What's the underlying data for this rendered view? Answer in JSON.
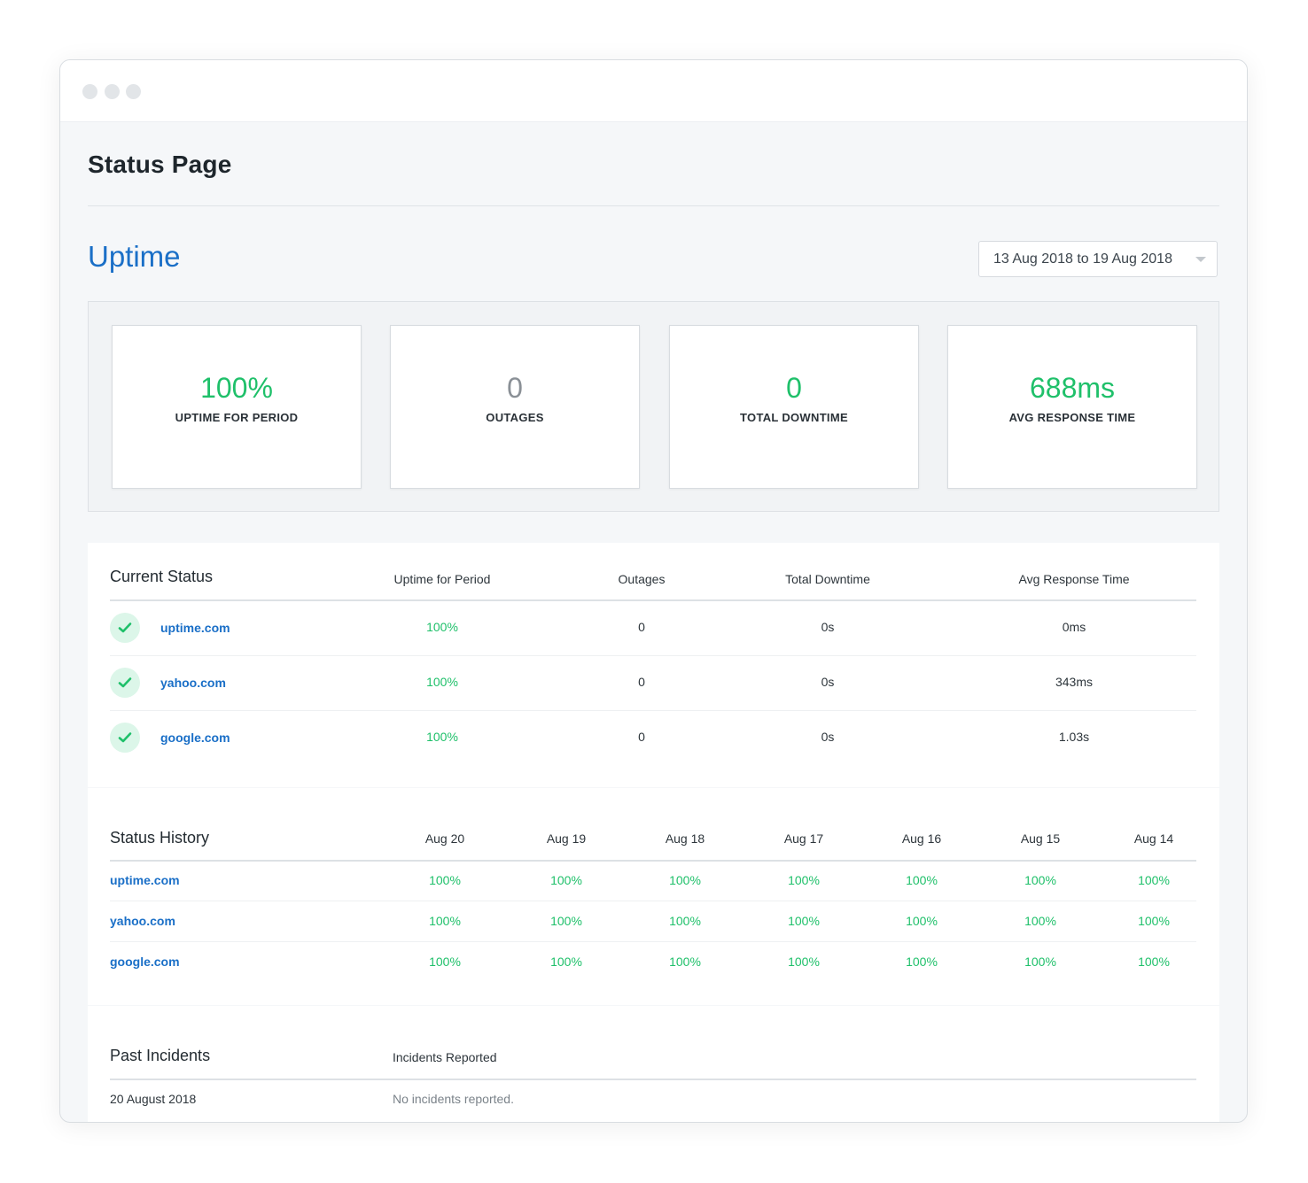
{
  "page": {
    "title": "Status Page"
  },
  "uptime": {
    "heading": "Uptime",
    "date_range": "13 Aug 2018 to 19 Aug 2018",
    "stats": [
      {
        "value": "100%",
        "label": "UPTIME FOR PERIOD"
      },
      {
        "value": "0",
        "label": "OUTAGES"
      },
      {
        "value": "0",
        "label": "TOTAL DOWNTIME"
      },
      {
        "value": "688ms",
        "label": "AVG RESPONSE TIME"
      }
    ]
  },
  "current_status": {
    "title": "Current Status",
    "columns": [
      "Uptime for Period",
      "Outages",
      "Total Downtime",
      "Avg Response Time"
    ],
    "rows": [
      {
        "site": "uptime.com",
        "uptime": "100%",
        "outages": "0",
        "downtime": "0s",
        "response": "0ms"
      },
      {
        "site": "yahoo.com",
        "uptime": "100%",
        "outages": "0",
        "downtime": "0s",
        "response": "343ms"
      },
      {
        "site": "google.com",
        "uptime": "100%",
        "outages": "0",
        "downtime": "0s",
        "response": "1.03s"
      }
    ]
  },
  "status_history": {
    "title": "Status History",
    "days": [
      "Aug 20",
      "Aug 19",
      "Aug 18",
      "Aug 17",
      "Aug 16",
      "Aug 15",
      "Aug 14"
    ],
    "rows": [
      {
        "site": "uptime.com",
        "values": [
          "100%",
          "100%",
          "100%",
          "100%",
          "100%",
          "100%",
          "100%"
        ]
      },
      {
        "site": "yahoo.com",
        "values": [
          "100%",
          "100%",
          "100%",
          "100%",
          "100%",
          "100%",
          "100%"
        ]
      },
      {
        "site": "google.com",
        "values": [
          "100%",
          "100%",
          "100%",
          "100%",
          "100%",
          "100%",
          "100%"
        ]
      }
    ]
  },
  "past_incidents": {
    "title": "Past Incidents",
    "column": "Incidents Reported",
    "rows": [
      {
        "date": "20 August 2018",
        "text": "No incidents reported."
      }
    ]
  },
  "colors": {
    "accent": "#1a6fc7",
    "success": "#1fc06a",
    "check_bg": "#dcf6e9"
  }
}
